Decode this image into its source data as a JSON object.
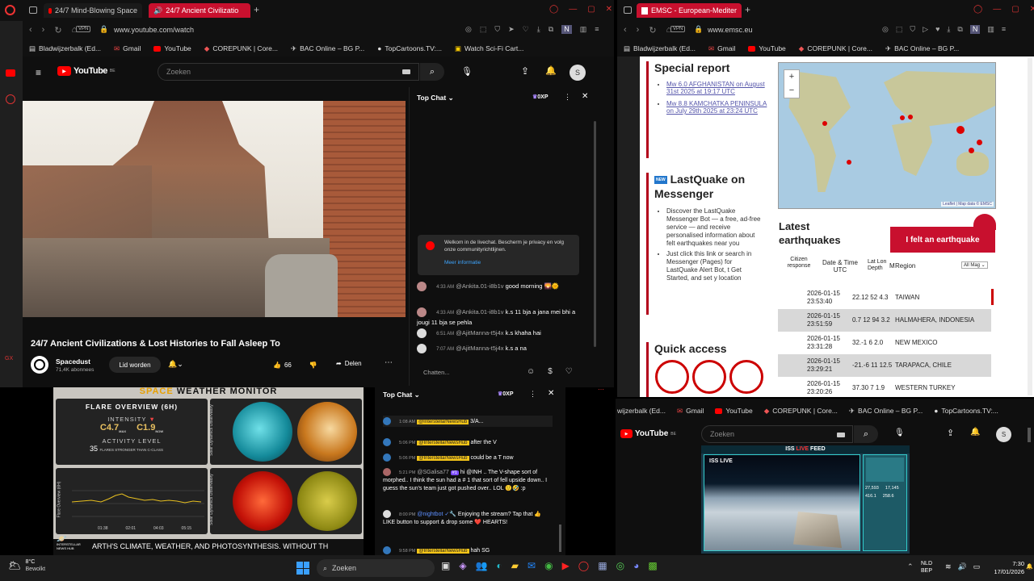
{
  "left_browser": {
    "tabs": [
      {
        "label": "24/7 Mind-Blowing Space",
        "active": false
      },
      {
        "label": "24/7 Ancient Civilizatio",
        "active": true
      }
    ],
    "url": "www.youtube.com/watch",
    "vpn_label": "VPN",
    "bookmarks": [
      "Bladwijzerbalk (Ed...",
      "Gmail",
      "YouTube",
      "COREPUNK | Core...",
      "BAC Online – BG P...",
      "TopCartoons.TV:...",
      "Watch Sci-Fi Cart..."
    ],
    "youtube": {
      "logo_text": "YouTube",
      "country": "BE",
      "search_placeholder": "Zoeken",
      "avatar_letter": "S",
      "video_title": "24/7 Ancient Civilizations & Lost Histories to Fall Asleep To",
      "channel_name": "Spacedust",
      "subscribers": "71,4K abonnees",
      "join_label": "Lid worden",
      "likes": "66",
      "share_label": "Delen",
      "chat": {
        "mode": "Top Chat",
        "points": "0XP",
        "welcome": "Welkom in de livechat. Bescherm je privacy en volg onze communityrichtlijnen.",
        "more_info": "Meer informatie",
        "messages": [
          {
            "time": "4:33 AM",
            "user": "@Ankita.01-i8b1v",
            "text": "good morning 🌄🌞"
          },
          {
            "time": "4:33 AM",
            "user": "@Ankita.01-i8b1v",
            "text": "k.s 11 bja a jana mei bhi a jougi 11 bja se pehla"
          },
          {
            "time": "6:51 AM",
            "user": "@AjitManna-t5j4x",
            "text": "k.s khaha hai"
          },
          {
            "time": "7:07 AM",
            "user": "@AjitManna-t5j4x",
            "text": "k.s a na"
          }
        ],
        "input_placeholder": "Chatten..."
      }
    }
  },
  "right_browser": {
    "tab_label": "EMSC - European-Mediter",
    "url": "www.emsc.eu",
    "vpn_label": "VPN",
    "bookmarks": [
      "Bladwijzerbalk (Ed...",
      "Gmail",
      "YouTube",
      "COREPUNK | Core...",
      "BAC Online – BG P..."
    ],
    "special_report": {
      "heading": "Special report",
      "links": [
        "Mw 6.0 AFGHANISTAN on August 31st 2025 at 19:17 UTC",
        "Mw 8.8 KAMCHATKA PENINSULA on July 29th 2025 at 23:24 UTC"
      ]
    },
    "lastquake": {
      "badge": "NEW",
      "heading": "LastQuake on Messenger",
      "bullets": [
        "Discover the LastQuake Messenger Bot — a free, ad-free service — and receive personalised information about felt earthquakes near you",
        "Just click this link or search in Messenger (Pages) for LastQuake Alert Bot, t Get Started, and set y location"
      ]
    },
    "quick_access": "Quick access",
    "map_attribution": "Leaflet | Map data © EMSC",
    "latest": {
      "heading": "Latest earthquakes",
      "felt_button": "I felt an earthquake",
      "col_citizen": "Citizen response",
      "col_datetime": "Date & Time UTC",
      "col_latlon": "Lat Lon Depth",
      "col_mag": "M",
      "col_region": "Region",
      "mag_filter": "All Mag",
      "rows": [
        {
          "date": "2026-01-15",
          "time": "23:53:40",
          "data": "22.12 52 4.3",
          "region": "TAIWAN"
        },
        {
          "date": "2026-01-15",
          "time": "23:51:59",
          "data": "0.7 12 94 3.2",
          "region": "HALMAHERA, INDONESIA"
        },
        {
          "date": "2026-01-15",
          "time": "23:31:28",
          "data": "32.-1 6 2.0",
          "region": "NEW MEXICO"
        },
        {
          "date": "2026-01-15",
          "time": "23:29:21",
          "data": "-21.-6 11 12.5",
          "region": "TARAPACA, CHILE"
        },
        {
          "date": "2026-01-15",
          "time": "23:20:26",
          "data": "37.30 7 1.9",
          "region": "WESTERN TURKEY"
        }
      ]
    }
  },
  "bottom_left": {
    "title_a": "SPACE",
    "title_b": "WEATHER MONITOR",
    "flare_title": "FLARE OVERVIEW (6H)",
    "intensity_label": "INTENSITY",
    "val1": "C4.7",
    "val1_sub": "MAX",
    "val2": "C1.9",
    "val2_sub": "NOW",
    "activity_label": "ACTIVITY LEVEL",
    "activity_num": "35",
    "activity_text": "FLARES STRONGER THAN C-CLASS",
    "sdo_label": "Solar Dynamics Observatory",
    "chart_label": "Flare Overview (6H)",
    "chart_times": [
      "01:38",
      "02:01",
      "04:03",
      "05:15"
    ],
    "ticker": "ARTH'S CLIMATE, WEATHER, AND PHOTOSYNTHESIS.   WITHOUT TH",
    "brand": "INTERSTELLAR NEWS HUB"
  },
  "bottom_chat": {
    "mode": "Top Chat",
    "points": "0XP",
    "messages": [
      {
        "time": "1:08 AM",
        "user": "@InterstellarNewsHub",
        "text": "3/A..."
      },
      {
        "time": "5:06 PM",
        "user": "@InterstellarNewsHub",
        "text": "after the V"
      },
      {
        "time": "5:06 PM",
        "user": "@InterstellarNewsHub",
        "text": "could be a T now"
      },
      {
        "time": "5:21 PM",
        "user": "@SGalisa77",
        "badge": "#1",
        "text": "hi @INH .. The V-shape sort of morphed.. I think the sun had a # 1 that sort of fell upside down.. I guess the sun's team just got pushed over.. LOL 🙂🤣 :p"
      },
      {
        "time": "8:00 PM",
        "user": "@nightbot",
        "text": "Enjoying the stream? Tap that 👍 LIKE button to support & drop some ❤️ HEARTS!"
      },
      {
        "time": "9:58 PM",
        "user": "@InterstellarNewsHub",
        "text": "hah SG"
      }
    ]
  },
  "bottom_right": {
    "bookmarks": [
      "wijzerbalk (Ed...",
      "Gmail",
      "YouTube",
      "COREPUNK | Core...",
      "BAC Online – BG P...",
      "TopCartoons.TV:..."
    ],
    "search_placeholder": "Zoeken",
    "logo_text": "YouTube",
    "country": "BE",
    "avatar_letter": "S",
    "iss_header_a": "ISS",
    "iss_header_b": "LIVE",
    "iss_header_c": "FEED",
    "iss_live": "ISS LIVE",
    "stats": [
      "27,593",
      "17,145",
      "416.1",
      "258.6"
    ]
  },
  "taskbar": {
    "temp": "8°C",
    "weather": "Bewolkt",
    "search_placeholder": "Zoeken",
    "lang_a": "NLD",
    "lang_b": "BEP",
    "time": "7:30",
    "date": "17/01/2026"
  }
}
